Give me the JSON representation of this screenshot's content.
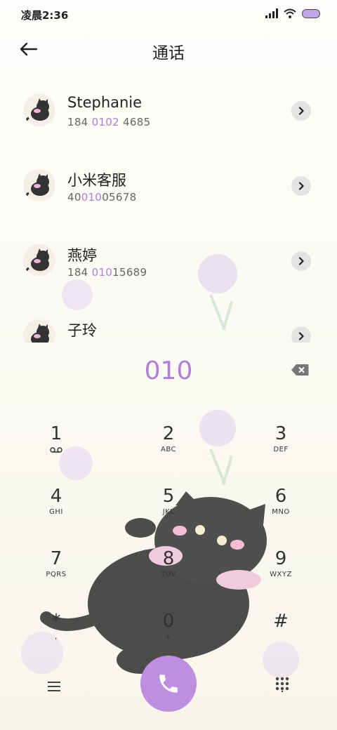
{
  "status_bar": {
    "time": "凌晨2:36"
  },
  "header": {
    "title": "通话"
  },
  "contacts": [
    {
      "name": "Stephanie",
      "num_pre": "184 ",
      "num_hl": "0102",
      "num_post": " 4685"
    },
    {
      "name": "小米客服",
      "num_pre": "40",
      "num_hl": "010",
      "num_post": "05678"
    },
    {
      "name": "燕婷",
      "num_pre": "184 ",
      "num_hl": "010",
      "num_post": "15689"
    },
    {
      "name": "子玲",
      "num_pre": "",
      "num_hl": "",
      "num_post": ""
    }
  ],
  "dialer": {
    "input": "010",
    "keys": [
      {
        "digit": "1",
        "letters": ""
      },
      {
        "digit": "2",
        "letters": "ABC"
      },
      {
        "digit": "3",
        "letters": "DEF"
      },
      {
        "digit": "4",
        "letters": "GHI"
      },
      {
        "digit": "5",
        "letters": "JKL"
      },
      {
        "digit": "6",
        "letters": "MNO"
      },
      {
        "digit": "7",
        "letters": "PQRS"
      },
      {
        "digit": "8",
        "letters": "TUV"
      },
      {
        "digit": "9",
        "letters": "WXYZ"
      },
      {
        "digit": "*",
        "letters": ","
      },
      {
        "digit": "0",
        "letters": "+"
      },
      {
        "digit": "#",
        "letters": ""
      }
    ]
  },
  "colors": {
    "accent": "#bf8fdf",
    "highlight": "#b27ed6"
  },
  "icons": [
    "back-arrow-icon",
    "chevron-right-icon",
    "backspace-icon",
    "voicemail-icon",
    "menu-icon",
    "phone-icon",
    "dialpad-icon",
    "signal-icon",
    "wifi-icon",
    "battery-icon",
    "cat-avatar-icon"
  ]
}
